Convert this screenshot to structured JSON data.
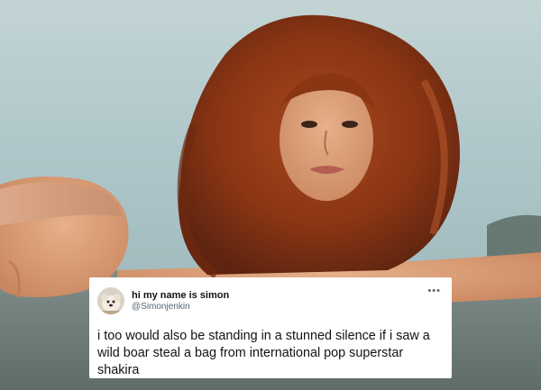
{
  "tweet": {
    "display_name": "hi my name is simon",
    "handle": "@Simonjenkin",
    "text": "i too would also be standing in a stunned silence if i saw a wild boar steal a bag from international pop superstar shakira",
    "more_icon": "more-horizontal-icon",
    "avatar_icon": "dog-avatar"
  },
  "colors": {
    "card_background": "#ffffff",
    "text_primary": "#0f1419",
    "text_secondary": "#536471"
  }
}
